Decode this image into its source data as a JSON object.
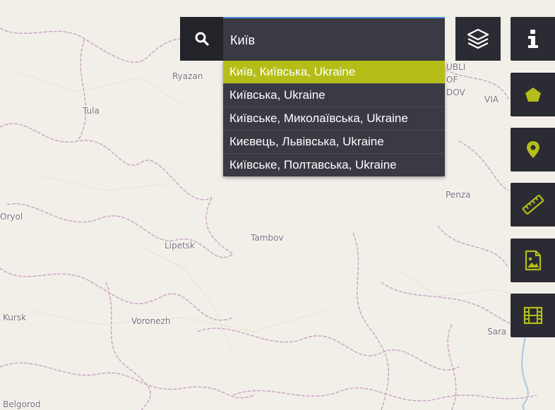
{
  "map": {
    "labels": [
      "Ryazan",
      "Tula",
      "Oryol",
      "Lipetsk",
      "Tambov",
      "Penza",
      "Kursk",
      "Voronezh",
      "Sara",
      "Belgorod",
      "UBLI",
      "OF",
      "DOV",
      "VIA"
    ]
  },
  "search": {
    "value": "Київ",
    "placeholder": ""
  },
  "suggestions": [
    {
      "label": "Київ, Київська, Ukraine",
      "active": true
    },
    {
      "label": "Київська, Ukraine",
      "active": false
    },
    {
      "label": "Київське, Миколаївська, Ukraine",
      "active": false
    },
    {
      "label": "Києвець, Львівська, Ukraine",
      "active": false
    },
    {
      "label": "Київське, Полтавська, Ukraine",
      "active": false
    }
  ],
  "tools": {
    "icons": [
      "search-icon",
      "layers-icon",
      "info-icon",
      "polygon-icon",
      "marker-icon",
      "ruler-icon",
      "image-export-icon",
      "film-icon"
    ],
    "accent": "#b5be18",
    "panel": "#2b2b33"
  }
}
